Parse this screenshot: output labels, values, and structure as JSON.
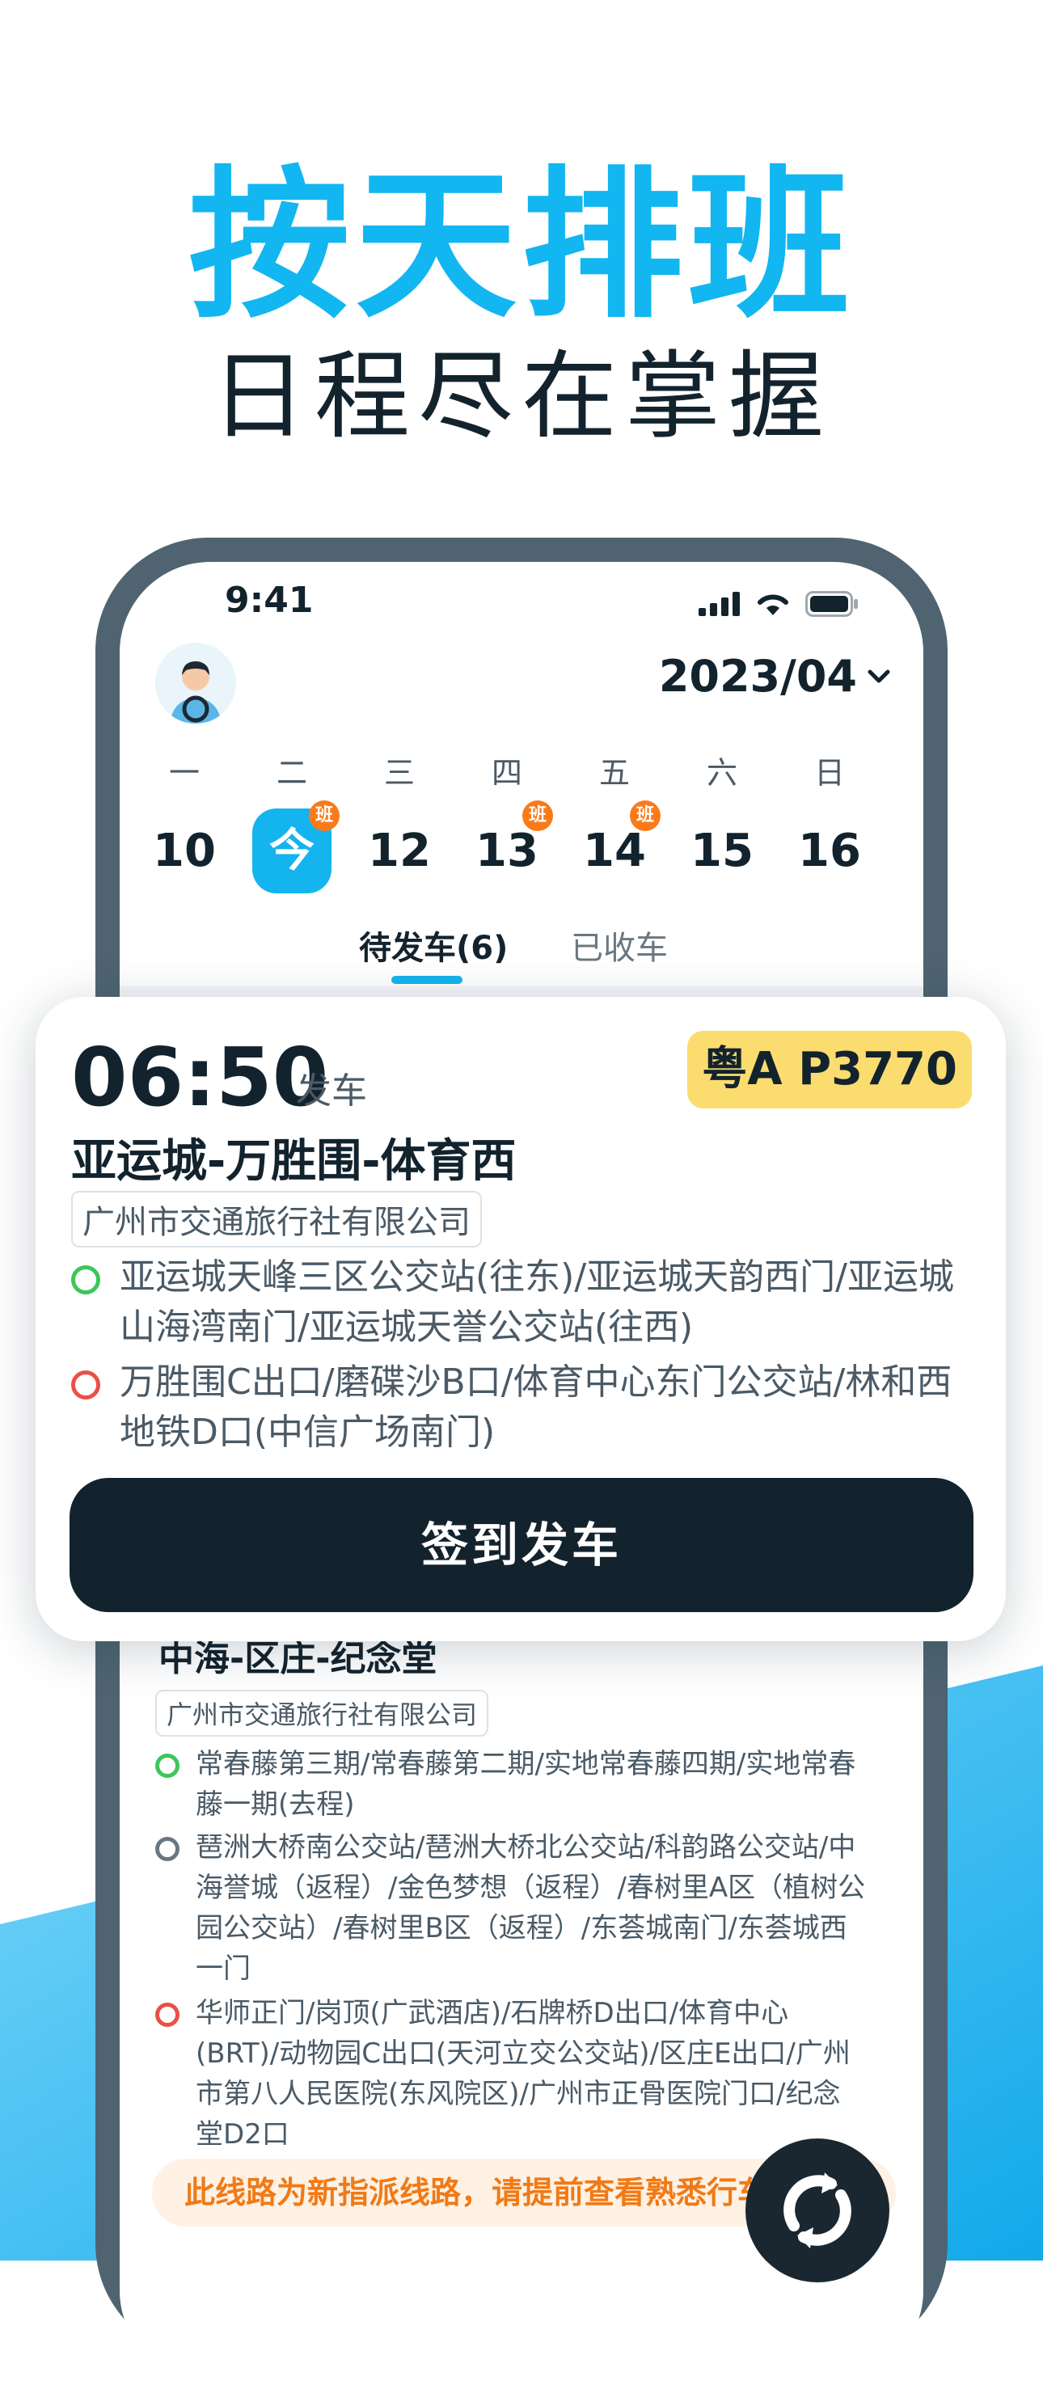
{
  "promo": {
    "title": "按天排班",
    "subtitle": "日程尽在掌握"
  },
  "colors": {
    "accent": "#14b4ee",
    "dark": "#13232e",
    "badge": "#fa7a1a",
    "plate": "#fbdc6e",
    "notice_bg": "#fff1e4",
    "notice_text": "#f07a16"
  },
  "status_bar": {
    "time": "9:41",
    "icons": [
      "signal-icon",
      "wifi-icon",
      "battery-icon"
    ]
  },
  "header": {
    "avatar": "driver-avatar",
    "month": "2023/04"
  },
  "calendar": {
    "weekdays": [
      "一",
      "二",
      "三",
      "四",
      "五",
      "六",
      "日"
    ],
    "dates": [
      "10",
      "今",
      "12",
      "13",
      "14",
      "15",
      "16"
    ],
    "selected_index": 1,
    "shift_badge": "班",
    "shift_indices": [
      1,
      3,
      4
    ]
  },
  "tabs": [
    {
      "label": "待发车(6)",
      "active": true
    },
    {
      "label": "已收车",
      "active": false
    }
  ],
  "trip_card": {
    "time": "06:50",
    "depart_label": "发车",
    "plate": "粤A P3770",
    "route": "亚运城-万胜围-体育西",
    "company": "广州市交通旅行社有限公司",
    "start_stops": "亚运城天峰三区公交站(往东)/亚运城天韵西门/亚运城山海湾南门/亚运城天誉公交站(往西)",
    "end_stops": "万胜围C出口/磨碟沙B口/体育中心东门公交站/林和西地铁D口(中信广场南门)",
    "button": "签到发车"
  },
  "trip_card_2": {
    "route": "中海-区庄-纪念堂",
    "company": "广州市交通旅行社有限公司",
    "start_stops": "常春藤第三期/常春藤第二期/实地常春藤四期/实地常春藤一期(去程)",
    "mid_stops": "琶洲大桥南公交站/琶洲大桥北公交站/科韵路公交站/中海誉城（返程）/金色梦想（返程）/春树里A区（植树公园公交站）/春树里B区（返程）/东荟城南门/东荟城西一门",
    "end_stops": "华师正门/岗顶(广武酒店)/石牌桥D出口/体育中心(BRT)/动物园C出口(天河立交公交站)/区庄E出口/广州市第八人民医院(东风院区)/广州市正骨医院门口/纪念堂D2口",
    "notice": "此线路为新指派线路，请提前查看熟悉行车",
    "refresh_icon": "refresh-icon"
  }
}
